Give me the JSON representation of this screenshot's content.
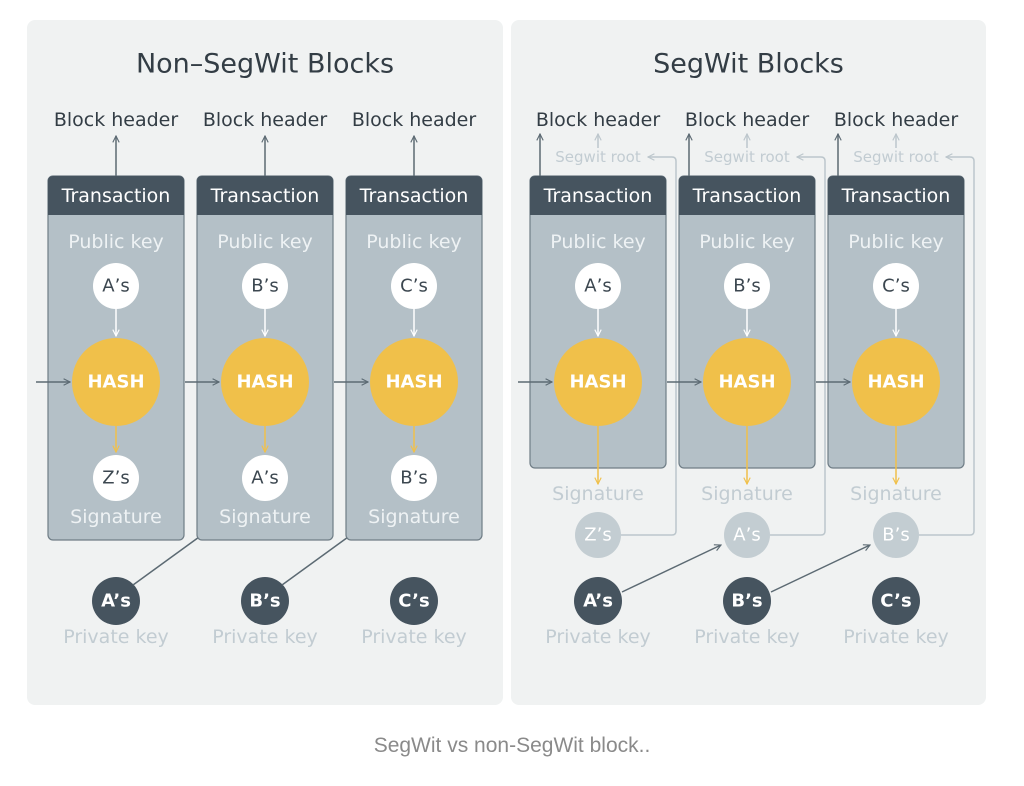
{
  "colors": {
    "panel_bg": "#f0f2f2",
    "block_body": "#b4c0c7",
    "block_header": "#46545f",
    "hash": "#f0c04a",
    "dark_text": "#3c4750",
    "faded_text": "#c2ccd2",
    "line": "#5c6a73",
    "faded_line": "#bcc6cc"
  },
  "panels": [
    {
      "title": "Non–SegWit Blocks",
      "blocks": [
        {
          "header_label": "Block header",
          "transaction_label": "Transaction",
          "public_key_label": "Public key",
          "public_key": "A’s",
          "hash_label": "HASH",
          "signature": "Z’s",
          "signature_label": "Signature",
          "private_key": "A’s",
          "private_key_label": "Private key"
        },
        {
          "header_label": "Block header",
          "transaction_label": "Transaction",
          "public_key_label": "Public key",
          "public_key": "B’s",
          "hash_label": "HASH",
          "signature": "A’s",
          "signature_label": "Signature",
          "private_key": "B’s",
          "private_key_label": "Private key"
        },
        {
          "header_label": "Block header",
          "transaction_label": "Transaction",
          "public_key_label": "Public key",
          "public_key": "C’s",
          "hash_label": "HASH",
          "signature": "B’s",
          "signature_label": "Signature",
          "private_key": "C’s",
          "private_key_label": "Private key"
        }
      ]
    },
    {
      "title": "SegWit Blocks",
      "blocks": [
        {
          "header_label": "Block header",
          "segwit_root_label": "Segwit root",
          "transaction_label": "Transaction",
          "public_key_label": "Public key",
          "public_key": "A’s",
          "hash_label": "HASH",
          "signature": "Z’s",
          "signature_label": "Signature",
          "private_key": "A’s",
          "private_key_label": "Private key"
        },
        {
          "header_label": "Block header",
          "segwit_root_label": "Segwit root",
          "transaction_label": "Transaction",
          "public_key_label": "Public key",
          "public_key": "B’s",
          "hash_label": "HASH",
          "signature": "A’s",
          "signature_label": "Signature",
          "private_key": "B’s",
          "private_key_label": "Private key"
        },
        {
          "header_label": "Block header",
          "segwit_root_label": "Segwit root",
          "transaction_label": "Transaction",
          "public_key_label": "Public key",
          "public_key": "C’s",
          "hash_label": "HASH",
          "signature": "B’s",
          "signature_label": "Signature",
          "private_key": "C’s",
          "private_key_label": "Private key"
        }
      ]
    }
  ],
  "caption": "SegWit vs non-SegWit block.."
}
